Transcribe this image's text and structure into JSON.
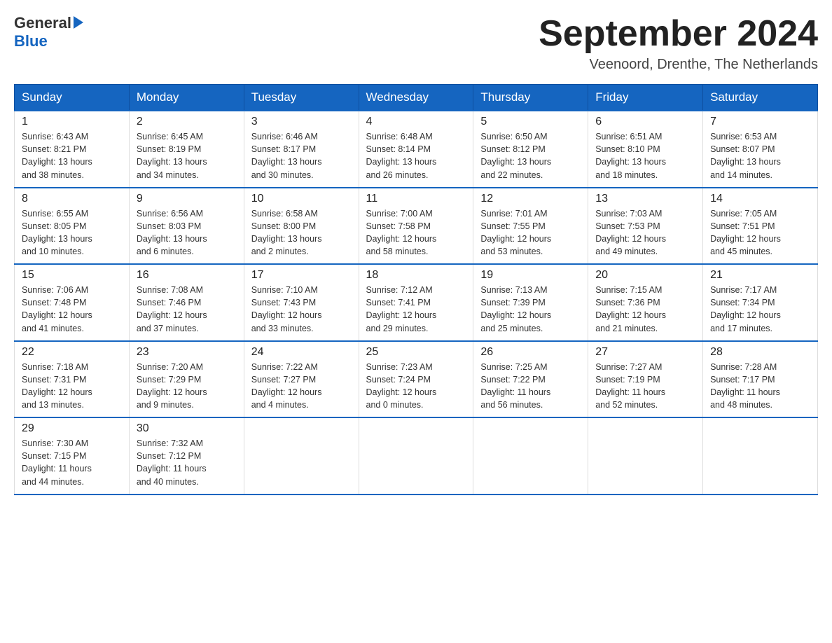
{
  "header": {
    "logo_general": "General",
    "logo_blue": "Blue",
    "month_title": "September 2024",
    "location": "Veenoord, Drenthe, The Netherlands"
  },
  "weekdays": [
    "Sunday",
    "Monday",
    "Tuesday",
    "Wednesday",
    "Thursday",
    "Friday",
    "Saturday"
  ],
  "weeks": [
    [
      {
        "day": "1",
        "sunrise": "6:43 AM",
        "sunset": "8:21 PM",
        "daylight": "13 hours and 38 minutes."
      },
      {
        "day": "2",
        "sunrise": "6:45 AM",
        "sunset": "8:19 PM",
        "daylight": "13 hours and 34 minutes."
      },
      {
        "day": "3",
        "sunrise": "6:46 AM",
        "sunset": "8:17 PM",
        "daylight": "13 hours and 30 minutes."
      },
      {
        "day": "4",
        "sunrise": "6:48 AM",
        "sunset": "8:14 PM",
        "daylight": "13 hours and 26 minutes."
      },
      {
        "day": "5",
        "sunrise": "6:50 AM",
        "sunset": "8:12 PM",
        "daylight": "13 hours and 22 minutes."
      },
      {
        "day": "6",
        "sunrise": "6:51 AM",
        "sunset": "8:10 PM",
        "daylight": "13 hours and 18 minutes."
      },
      {
        "day": "7",
        "sunrise": "6:53 AM",
        "sunset": "8:07 PM",
        "daylight": "13 hours and 14 minutes."
      }
    ],
    [
      {
        "day": "8",
        "sunrise": "6:55 AM",
        "sunset": "8:05 PM",
        "daylight": "13 hours and 10 minutes."
      },
      {
        "day": "9",
        "sunrise": "6:56 AM",
        "sunset": "8:03 PM",
        "daylight": "13 hours and 6 minutes."
      },
      {
        "day": "10",
        "sunrise": "6:58 AM",
        "sunset": "8:00 PM",
        "daylight": "13 hours and 2 minutes."
      },
      {
        "day": "11",
        "sunrise": "7:00 AM",
        "sunset": "7:58 PM",
        "daylight": "12 hours and 58 minutes."
      },
      {
        "day": "12",
        "sunrise": "7:01 AM",
        "sunset": "7:55 PM",
        "daylight": "12 hours and 53 minutes."
      },
      {
        "day": "13",
        "sunrise": "7:03 AM",
        "sunset": "7:53 PM",
        "daylight": "12 hours and 49 minutes."
      },
      {
        "day": "14",
        "sunrise": "7:05 AM",
        "sunset": "7:51 PM",
        "daylight": "12 hours and 45 minutes."
      }
    ],
    [
      {
        "day": "15",
        "sunrise": "7:06 AM",
        "sunset": "7:48 PM",
        "daylight": "12 hours and 41 minutes."
      },
      {
        "day": "16",
        "sunrise": "7:08 AM",
        "sunset": "7:46 PM",
        "daylight": "12 hours and 37 minutes."
      },
      {
        "day": "17",
        "sunrise": "7:10 AM",
        "sunset": "7:43 PM",
        "daylight": "12 hours and 33 minutes."
      },
      {
        "day": "18",
        "sunrise": "7:12 AM",
        "sunset": "7:41 PM",
        "daylight": "12 hours and 29 minutes."
      },
      {
        "day": "19",
        "sunrise": "7:13 AM",
        "sunset": "7:39 PM",
        "daylight": "12 hours and 25 minutes."
      },
      {
        "day": "20",
        "sunrise": "7:15 AM",
        "sunset": "7:36 PM",
        "daylight": "12 hours and 21 minutes."
      },
      {
        "day": "21",
        "sunrise": "7:17 AM",
        "sunset": "7:34 PM",
        "daylight": "12 hours and 17 minutes."
      }
    ],
    [
      {
        "day": "22",
        "sunrise": "7:18 AM",
        "sunset": "7:31 PM",
        "daylight": "12 hours and 13 minutes."
      },
      {
        "day": "23",
        "sunrise": "7:20 AM",
        "sunset": "7:29 PM",
        "daylight": "12 hours and 9 minutes."
      },
      {
        "day": "24",
        "sunrise": "7:22 AM",
        "sunset": "7:27 PM",
        "daylight": "12 hours and 4 minutes."
      },
      {
        "day": "25",
        "sunrise": "7:23 AM",
        "sunset": "7:24 PM",
        "daylight": "12 hours and 0 minutes."
      },
      {
        "day": "26",
        "sunrise": "7:25 AM",
        "sunset": "7:22 PM",
        "daylight": "11 hours and 56 minutes."
      },
      {
        "day": "27",
        "sunrise": "7:27 AM",
        "sunset": "7:19 PM",
        "daylight": "11 hours and 52 minutes."
      },
      {
        "day": "28",
        "sunrise": "7:28 AM",
        "sunset": "7:17 PM",
        "daylight": "11 hours and 48 minutes."
      }
    ],
    [
      {
        "day": "29",
        "sunrise": "7:30 AM",
        "sunset": "7:15 PM",
        "daylight": "11 hours and 44 minutes."
      },
      {
        "day": "30",
        "sunrise": "7:32 AM",
        "sunset": "7:12 PM",
        "daylight": "11 hours and 40 minutes."
      },
      null,
      null,
      null,
      null,
      null
    ]
  ],
  "labels": {
    "sunrise_prefix": "Sunrise: ",
    "sunset_prefix": "Sunset: ",
    "daylight_prefix": "Daylight: "
  }
}
